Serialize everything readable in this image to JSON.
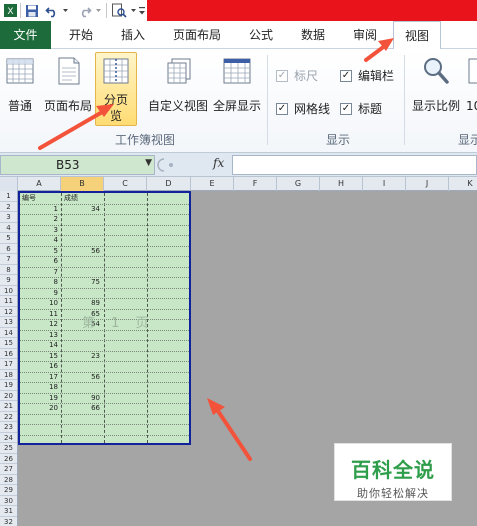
{
  "qat": {
    "icons": [
      "excel-logo-icon",
      "save-icon",
      "undo-icon",
      "redo-icon",
      "print-preview-icon",
      "customize-icon"
    ]
  },
  "tabs": [
    {
      "label": "文件",
      "active": false
    },
    {
      "label": "开始",
      "active": false
    },
    {
      "label": "插入",
      "active": false
    },
    {
      "label": "页面布局",
      "active": false
    },
    {
      "label": "公式",
      "active": false
    },
    {
      "label": "数据",
      "active": false
    },
    {
      "label": "审阅",
      "active": false
    },
    {
      "label": "视图",
      "active": true
    }
  ],
  "ribbon": {
    "workbook_views": {
      "normal": "普通",
      "page_layout": "页面布局",
      "page_break_preview_line1": "分页",
      "page_break_preview_line2": "览",
      "custom_views": "自定义视图",
      "full_screen": "全屏显示",
      "group_label": "工作簿视图"
    },
    "show": {
      "ruler": "标尺",
      "formula_bar": "编辑栏",
      "gridlines": "网格线",
      "headings": "标题",
      "ruler_checked": true,
      "ruler_disabled": true,
      "formula_bar_checked": true,
      "gridlines_checked": true,
      "headings_checked": true,
      "group_label": "显示"
    },
    "zoom": {
      "zoom_label": "显示比例",
      "zoom_100_partial": "10",
      "group_label_partial": "显示"
    }
  },
  "formula_bar": {
    "name_box": "B53",
    "fx": "fx",
    "content": ""
  },
  "sheet": {
    "columns": [
      "A",
      "B",
      "C",
      "D",
      "E",
      "F",
      "G",
      "H",
      "I",
      "J",
      "K"
    ],
    "selected_column": "B",
    "rows": [
      "1",
      "2",
      "3",
      "4",
      "5",
      "6",
      "7",
      "8",
      "9",
      "10",
      "11",
      "12",
      "13",
      "14",
      "15",
      "16",
      "17",
      "18",
      "19",
      "20",
      "21",
      "22",
      "23",
      "24",
      "25",
      "26",
      "27",
      "28",
      "29",
      "30",
      "31",
      "32"
    ],
    "header_a": "编号",
    "header_b": "成绩",
    "data": [
      {
        "a": "1",
        "b": "34"
      },
      {
        "a": "2",
        "b": ""
      },
      {
        "a": "3",
        "b": ""
      },
      {
        "a": "4",
        "b": ""
      },
      {
        "a": "5",
        "b": "56"
      },
      {
        "a": "6",
        "b": ""
      },
      {
        "a": "7",
        "b": ""
      },
      {
        "a": "8",
        "b": "75"
      },
      {
        "a": "9",
        "b": ""
      },
      {
        "a": "10",
        "b": "89"
      },
      {
        "a": "11",
        "b": "65"
      },
      {
        "a": "12",
        "b": "54"
      },
      {
        "a": "13",
        "b": ""
      },
      {
        "a": "14",
        "b": ""
      },
      {
        "a": "15",
        "b": "23"
      },
      {
        "a": "16",
        "b": ""
      },
      {
        "a": "17",
        "b": "56"
      },
      {
        "a": "18",
        "b": ""
      },
      {
        "a": "19",
        "b": "90"
      },
      {
        "a": "20",
        "b": "66"
      }
    ],
    "watermark": "第 1 页"
  },
  "badge": {
    "title": "百科全说",
    "subtitle": "助你轻松解决"
  },
  "colors": {
    "file_tab": "#1d6a3a",
    "title_band": "#e8131b",
    "print_area_fill": "#c7e7c7",
    "print_area_border": "#12229b",
    "arrow": "#f2533a",
    "badge_text": "#2f9e4b"
  }
}
